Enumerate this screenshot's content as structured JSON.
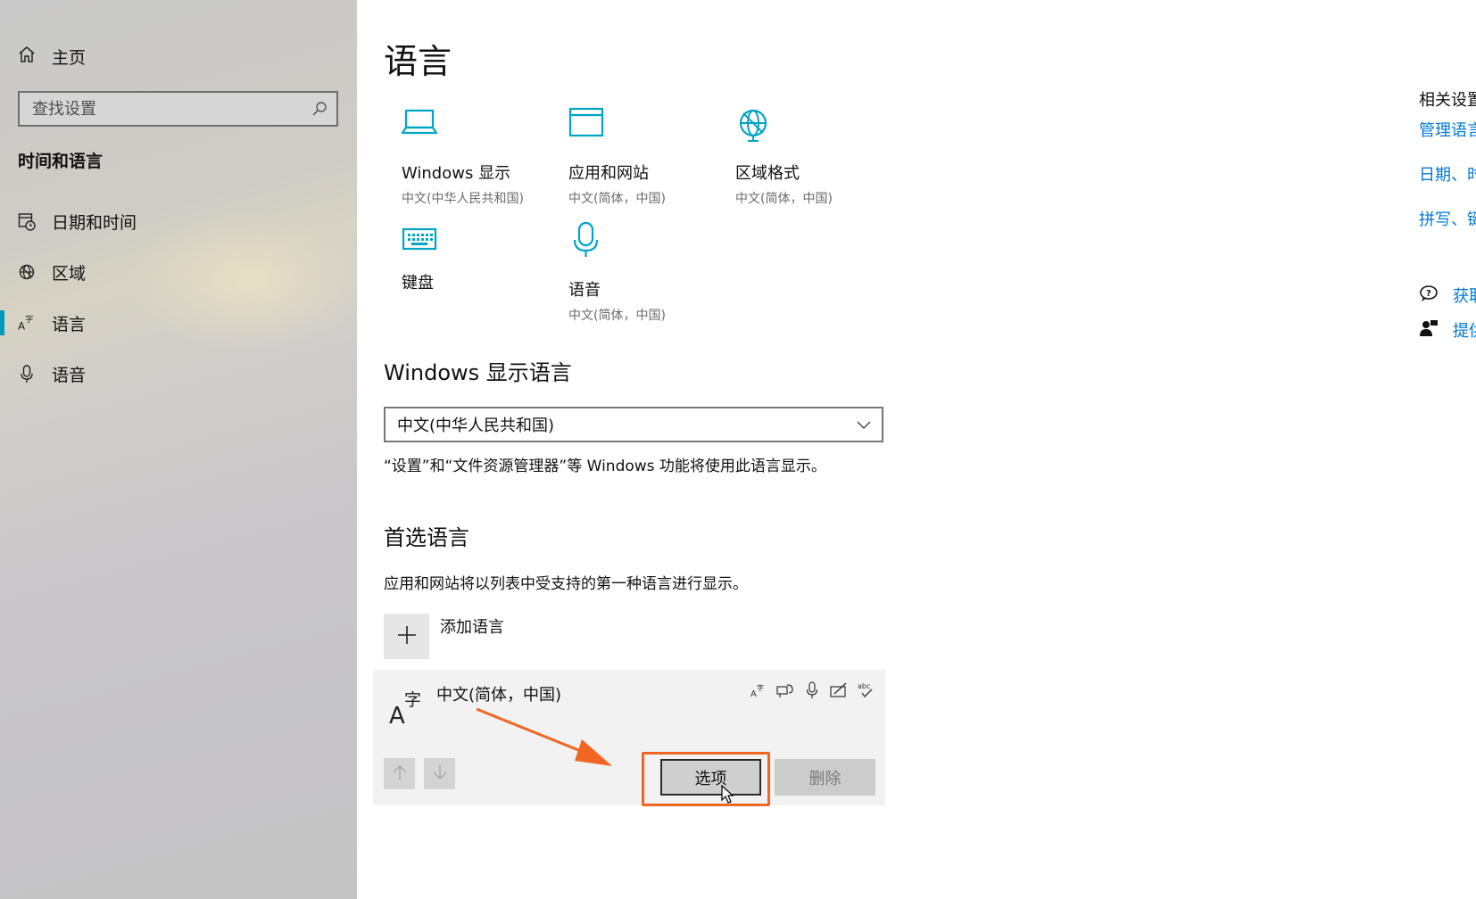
{
  "sidebar": {
    "home_label": "主页",
    "search_placeholder": "查找设置",
    "section_title": "时间和语言",
    "items": [
      {
        "label": "日期和时间",
        "icon": "calendar-clock-icon"
      },
      {
        "label": "区域",
        "icon": "globe-icon"
      },
      {
        "label": "语言",
        "icon": "language-icon"
      },
      {
        "label": "语音",
        "icon": "microphone-icon"
      }
    ],
    "active_item": "语言"
  },
  "main": {
    "title": "语言",
    "tiles": [
      {
        "label": "Windows 显示",
        "sub": "中文(中华人民共和国)",
        "icon": "laptop-icon"
      },
      {
        "label": "应用和网站",
        "sub": "中文(简体，中国)",
        "icon": "window-icon"
      },
      {
        "label": "区域格式",
        "sub": "中文(简体，中国)",
        "icon": "globe-icon"
      },
      {
        "label": "键盘",
        "sub": "",
        "icon": "keyboard-icon"
      },
      {
        "label": "语音",
        "sub": "中文(简体，中国)",
        "icon": "microphone-icon"
      }
    ],
    "display_language": {
      "heading": "Windows 显示语言",
      "selected": "中文(中华人民共和国)",
      "description": "“设置”和“文件资源管理器”等 Windows 功能将使用此语言显示。"
    },
    "preferred": {
      "heading": "首选语言",
      "description": "应用和网站将以列表中受支持的第一种语言进行显示。",
      "add_label": "添加语言",
      "language_name": "中文(简体，中国)",
      "options_label": "选项",
      "remove_label": "删除"
    }
  },
  "related": {
    "title": "相关设置",
    "links": [
      "管理语言",
      "日期、时",
      "拼写、键"
    ],
    "help": [
      "获取",
      "提供"
    ]
  },
  "colors": {
    "accent": "#0099bc",
    "tile_icon": "#00a4c7",
    "link": "#0078d7",
    "highlight": "#f26522"
  }
}
